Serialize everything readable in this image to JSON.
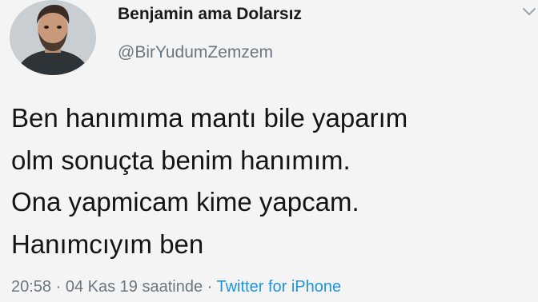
{
  "user": {
    "display_name": "Benjamin ama Dolarsız",
    "handle": "@BirYudumZemzem"
  },
  "tweet": {
    "lines": [
      "Ben hanımıma mantı bile yaparım",
      "olm sonuçta benim hanımım.",
      "Ona yapmicam kime yapcam.",
      "Hanımcıyım ben"
    ]
  },
  "meta": {
    "timestamp": "20:58 · 04 Kas 19 saatinde",
    "separator": " · ",
    "source": "Twitter for iPhone"
  },
  "icons": {
    "menu": "chevron-down-icon",
    "avatar": "profile-photo"
  },
  "colors": {
    "background": "#f4f4f4",
    "text": "#141414",
    "secondary": "#6b7680",
    "link": "#1b95e0"
  }
}
